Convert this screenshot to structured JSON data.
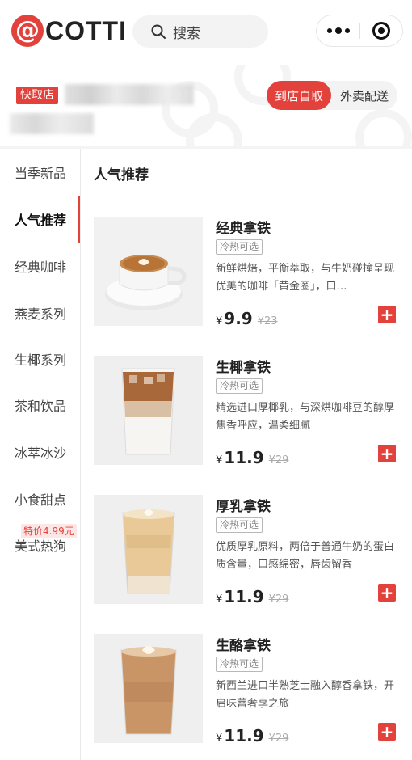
{
  "header": {
    "logo_text": "COTTI",
    "logo_symbol": "@",
    "search": {
      "icon": "search-icon",
      "placeholder": "搜索"
    },
    "capsule": {
      "more_icon": "more-dots-icon",
      "close_icon": "close-target-icon"
    }
  },
  "store": {
    "type_tag": "快取店",
    "mode_options": [
      "到店自取",
      "外卖配送"
    ],
    "mode_selected": "到店自取"
  },
  "sidebar": {
    "categories": [
      {
        "label": "当季新品",
        "active": false
      },
      {
        "label": "人气推荐",
        "active": true
      },
      {
        "label": "经典咖啡",
        "active": false
      },
      {
        "label": "燕麦系列",
        "active": false
      },
      {
        "label": "生椰系列",
        "active": false
      },
      {
        "label": "茶和饮品",
        "active": false
      },
      {
        "label": "冰萃冰沙",
        "active": false
      },
      {
        "label": "小食甜点",
        "active": false
      },
      {
        "label": "美式热狗",
        "active": false
      }
    ],
    "promo_badge": "特价4.99元"
  },
  "main": {
    "section_title": "人气推荐",
    "currency": "¥",
    "products": [
      {
        "name": "经典拿铁",
        "tag": "冷热可选",
        "desc": "新鲜烘焙，平衡萃取，与牛奶碰撞呈现优美的咖啡「黄金圈」，口…",
        "price": "9.9",
        "original_price": "¥23",
        "image_icon": "hot-latte-cup-image"
      },
      {
        "name": "生椰拿铁",
        "tag": "冷热可选",
        "desc": "精选进口厚椰乳，与深烘咖啡豆的醇厚焦香呼应，温柔细腻",
        "price": "11.9",
        "original_price": "¥29",
        "image_icon": "iced-coconut-latte-image"
      },
      {
        "name": "厚乳拿铁",
        "tag": "冷热可选",
        "desc": "优质厚乳原料，两倍于普通牛奶的蛋白质含量，口感绵密，唇齿留香",
        "price": "11.9",
        "original_price": "¥29",
        "image_icon": "latte-glass-image"
      },
      {
        "name": "生酪拿铁",
        "tag": "冷热可选",
        "desc": "新西兰进口半熟芝士融入醇香拿铁，开启味蕾奢享之旅",
        "price": "11.9",
        "original_price": "¥29",
        "image_icon": "cheese-latte-glass-image"
      }
    ],
    "add_icon": "plus-icon"
  },
  "colors": {
    "accent": "#e3413b",
    "text": "#222222",
    "muted": "#888888"
  }
}
